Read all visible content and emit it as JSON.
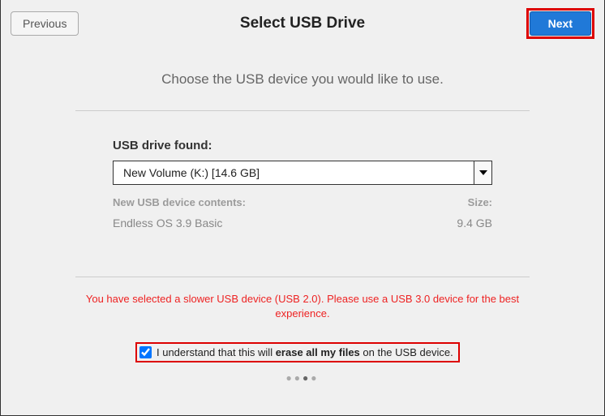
{
  "header": {
    "previous": "Previous",
    "title": "Select USB Drive",
    "next": "Next"
  },
  "instruction": "Choose the USB device you would like to use.",
  "drive": {
    "label": "USB drive found:",
    "selected": "New Volume (K:) [14.6 GB]"
  },
  "contents": {
    "label": "New USB device contents:",
    "value": "Endless OS 3.9 Basic"
  },
  "size": {
    "label": "Size:",
    "value": "9.4 GB"
  },
  "warning": "You have selected a slower USB device (USB 2.0). Please use a USB 3.0 device for the best experience.",
  "confirm": {
    "pre": "I understand that this will ",
    "bold": "erase all my files",
    "post": " on the USB device."
  },
  "step_index": 2,
  "step_total": 4
}
